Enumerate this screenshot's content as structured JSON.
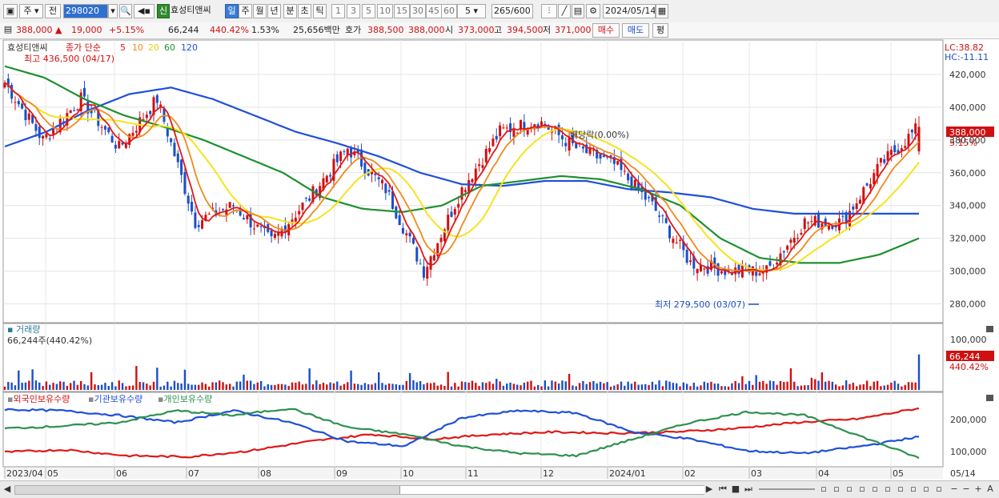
{
  "toolbar": {
    "period_select": "주",
    "prev_label": "전",
    "code": "298020",
    "badge_label": "신",
    "stock_name": "효성티앤씨",
    "periods": [
      "일",
      "주",
      "월",
      "년",
      "분",
      "초",
      "틱"
    ],
    "selected_period": "일",
    "intervals": [
      "1",
      "3",
      "5",
      "10",
      "15",
      "30",
      "45",
      "60"
    ],
    "interval_value": "5",
    "count_value": "265",
    "count_total": "/600",
    "date_value": "2024/05/14"
  },
  "quote": {
    "price": "388,000",
    "change": "19,000",
    "change_pct": "+5.15%",
    "volume": "66,244",
    "volume_pct": "440.42%",
    "turnover_pct": "1.53%",
    "amount": "25,656백만",
    "hoga_label": "호가",
    "ask": "388,500",
    "bid": "388,000",
    "open_label": "시",
    "open": "373,000",
    "high_label": "고",
    "high": "394,500",
    "low_label": "저",
    "low": "371,000",
    "buy_label": "매수",
    "sell_label": "매도",
    "avg_label": "평"
  },
  "price_panel": {
    "name": "효성티앤씨",
    "legend_prefix": "종가 단순",
    "ma_labels": [
      "5",
      "10",
      "20",
      "60",
      "120"
    ],
    "high_marker": "최고 436,500 (04/17)",
    "low_marker": "최저 279,500 (03/07)",
    "dividend_marker": "배당락(0.00%)",
    "lc": "LC:38.82",
    "hc": "HC:-11.11",
    "current_tag": "388,000",
    "current_pct": "5.15%",
    "y_labels": [
      "420,000",
      "400,000",
      "380,000",
      "360,000",
      "340,000",
      "320,000",
      "300,000",
      "280,000"
    ]
  },
  "volume_panel": {
    "title": "거래량",
    "subtitle": "66,244주(440.42%)",
    "y_labels": [
      "100,000",
      "50,000"
    ],
    "current_tag": "66,244",
    "current_pct": "440.42%"
  },
  "holding_panel": {
    "legend": [
      "외국인보유수량",
      "기관보유수량",
      "개인보유수량"
    ],
    "y_labels": [
      "200,000",
      "100,000"
    ]
  },
  "x_labels": [
    "2023/04",
    "05",
    "06",
    "07",
    "08",
    "09",
    "10",
    "11",
    "12",
    "2024/01",
    "02",
    "03",
    "04",
    "05"
  ],
  "x_right_label": "05/14",
  "colors": {
    "up": "#d01010",
    "down": "#1a4fc8",
    "ma5": "#e01818",
    "ma10": "#f08a1c",
    "ma20": "#f6e31f",
    "ma60": "#1f9030",
    "ma120": "#2050d8",
    "foreign": "#e01818",
    "institution": "#2050d8",
    "individual": "#2e9050"
  },
  "chart_data": {
    "type": "candlestick",
    "y_range": [
      270000,
      440000
    ],
    "months": [
      "2023/04",
      "05",
      "06",
      "07",
      "08",
      "09",
      "10",
      "11",
      "12",
      "2024/01",
      "02",
      "03",
      "04",
      "05"
    ],
    "close_approx": [
      415000,
      380000,
      405000,
      375000,
      405000,
      330000,
      340000,
      318000,
      345000,
      375000,
      350000,
      300000,
      350000,
      385000,
      392000,
      375000,
      365000,
      340000,
      305000,
      300000,
      300000,
      330000,
      330000,
      365000,
      388000
    ],
    "ma60_approx": [
      425000,
      418000,
      405000,
      395000,
      388000,
      380000,
      370000,
      360000,
      345000,
      338000,
      336000,
      340000,
      352000,
      355000,
      358000,
      356000,
      350000,
      340000,
      320000,
      308000,
      305000,
      305000,
      310000,
      320000
    ],
    "ma120_approx": [
      376000,
      385000,
      398000,
      408000,
      412000,
      405000,
      395000,
      385000,
      378000,
      370000,
      360000,
      353000,
      352000,
      355000,
      355000,
      350000,
      348000,
      345000,
      338000,
      335000,
      335000,
      335000,
      335000
    ],
    "volume_last": 66244,
    "volume_max_axis": 100000,
    "holding_last": {
      "foreign": 260000,
      "institution": 140000,
      "individual": 50000
    }
  }
}
